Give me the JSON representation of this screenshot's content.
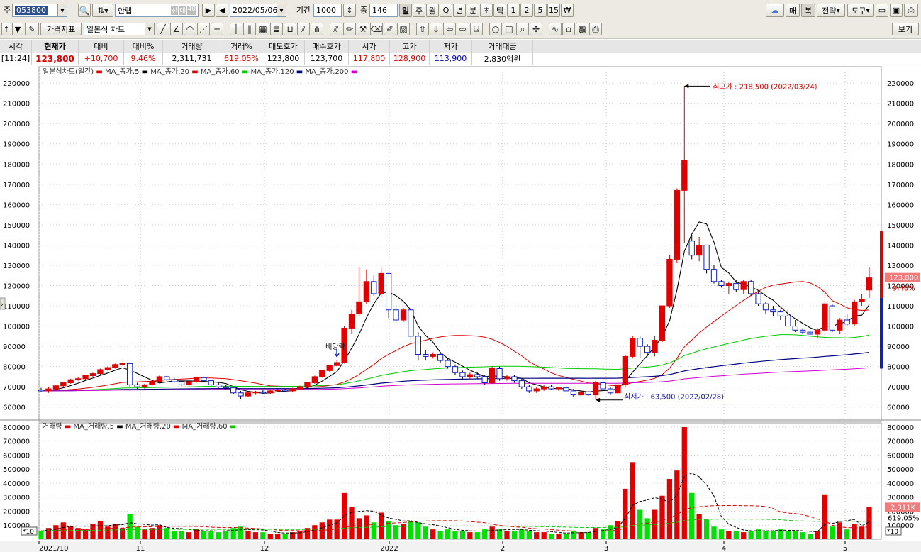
{
  "toolbar1": {
    "market_label": "주",
    "code": "053800",
    "name": "안랩",
    "badge_credit": "신",
    "badge_margin": "대",
    "badge_rate": "40",
    "date": "2022/05/06",
    "period_label": "기간",
    "period": "1000",
    "count_label": "중",
    "count": "146",
    "intervals": [
      "일",
      "주",
      "월",
      "Q",
      "년",
      "분",
      "초",
      "틱",
      "1",
      "2",
      "5",
      "15",
      "₩"
    ],
    "right_buttons": [
      "매",
      "복",
      "전략",
      "도구"
    ]
  },
  "toolbar2": {
    "indicator_button": "가격지표",
    "chart_type": "일본식 차트",
    "view_button": "보기"
  },
  "quote": {
    "headers": [
      "시각",
      "현재가",
      "대비",
      "대비%",
      "거래량",
      "거래%",
      "매도호가",
      "매수호가",
      "시가",
      "고가",
      "저가",
      "거래대금"
    ],
    "values": [
      "[11:24]",
      "123,800",
      "+10,700",
      "9.46%",
      "2,311,731",
      "619.05%",
      "123,800",
      "123,700",
      "117,800",
      "128,900",
      "113,900",
      "2,830억원"
    ]
  },
  "price_legend": {
    "title": "일본식차트(일간)",
    "items": [
      "MA_종가,5",
      "MA_종가,20",
      "MA_종가,60",
      "MA_종가,120",
      "MA_종가,200"
    ]
  },
  "volume_legend": {
    "title": "거래량",
    "items": [
      "MA_거래량,5",
      "MA_거래량,20",
      "MA_거래량,60"
    ]
  },
  "annotations": {
    "high": "최고가 : 218,500 (2022/03/24)",
    "low": "최저가 : 63,500 (2022/02/28)",
    "dividend": "배당락",
    "price_tag": "123,800",
    "change_tag": "9.46%",
    "volume_tag": "2,311K",
    "volume_pct_tag": "619.05%",
    "volume_unit": "*10"
  },
  "price_axis": [
    "220000",
    "210000",
    "200000",
    "190000",
    "180000",
    "170000",
    "160000",
    "150000",
    "140000",
    "130000",
    "120000",
    "110000",
    "100000",
    "90000",
    "80000",
    "70000",
    "60000"
  ],
  "volume_axis": [
    "800000",
    "700000",
    "600000",
    "500000",
    "400000",
    "300000",
    "200000",
    "100000"
  ],
  "date_axis": [
    "2021/10",
    "11",
    "12",
    "2022",
    "2",
    "3",
    "4",
    "5"
  ],
  "colors": {
    "up": "#e00000",
    "down": "#1020c0",
    "ma5": "#000000",
    "ma20": "#e00000",
    "ma60": "#00cc00",
    "ma120": "#000080",
    "ma200": "#d000d0",
    "vol_up": "#e00000",
    "vol_down": "#00e000"
  },
  "chart_data": {
    "type": "candlestick",
    "ylim": [
      55000,
      226000
    ],
    "volume_ylim": [
      0,
      830000
    ],
    "candles": [
      [
        68500,
        69500,
        67500,
        68000,
        60000
      ],
      [
        68000,
        70000,
        67000,
        69000,
        80000
      ],
      [
        69000,
        71000,
        68500,
        70500,
        100000
      ],
      [
        70500,
        72500,
        70000,
        72000,
        120000
      ],
      [
        72000,
        74000,
        71500,
        73500,
        90000
      ],
      [
        73500,
        75000,
        73000,
        74000,
        80000
      ],
      [
        74000,
        76000,
        73500,
        75500,
        70000
      ],
      [
        75500,
        77000,
        75000,
        76500,
        110000
      ],
      [
        76500,
        79000,
        76000,
        78500,
        130000
      ],
      [
        78500,
        80000,
        78000,
        79500,
        90000
      ],
      [
        79500,
        81500,
        79000,
        81000,
        110000
      ],
      [
        81000,
        82000,
        80500,
        81500,
        80000
      ],
      [
        81500,
        82000,
        70000,
        71000,
        180000
      ],
      [
        71000,
        72000,
        69000,
        70000,
        90000
      ],
      [
        70000,
        71500,
        69000,
        71000,
        70000
      ],
      [
        71000,
        73000,
        70500,
        72500,
        80000
      ],
      [
        72500,
        75500,
        72000,
        75000,
        100000
      ],
      [
        75000,
        75500,
        73000,
        73500,
        80000
      ],
      [
        73500,
        74500,
        72000,
        72500,
        60000
      ],
      [
        72500,
        73000,
        70500,
        71000,
        60000
      ],
      [
        71000,
        73000,
        70500,
        72500,
        50000
      ],
      [
        72500,
        75000,
        72000,
        74500,
        70000
      ],
      [
        74500,
        75000,
        72500,
        73000,
        60000
      ],
      [
        73000,
        73500,
        70500,
        71000,
        60000
      ],
      [
        71000,
        72000,
        69500,
        70000,
        50000
      ],
      [
        70000,
        71000,
        68500,
        69500,
        60000
      ],
      [
        69500,
        70000,
        66500,
        67000,
        80000
      ],
      [
        67000,
        68000,
        64000,
        65500,
        90000
      ],
      [
        65500,
        67500,
        65000,
        67000,
        60000
      ],
      [
        67000,
        68000,
        66000,
        67500,
        50000
      ],
      [
        67500,
        68500,
        66500,
        67000,
        50000
      ],
      [
        67000,
        68500,
        66500,
        68000,
        40000
      ],
      [
        68000,
        69000,
        67500,
        68500,
        40000
      ],
      [
        68500,
        69000,
        67500,
        68000,
        40000
      ],
      [
        68000,
        69500,
        67500,
        69000,
        50000
      ],
      [
        69000,
        70500,
        68500,
        70000,
        60000
      ],
      [
        70000,
        72500,
        69500,
        72000,
        80000
      ],
      [
        72000,
        75500,
        71500,
        75000,
        100000
      ],
      [
        75000,
        78500,
        74500,
        78000,
        120000
      ],
      [
        78000,
        81000,
        77500,
        80500,
        140000
      ],
      [
        80500,
        83000,
        80000,
        82000,
        140000
      ],
      [
        82000,
        100000,
        81500,
        99000,
        330000
      ],
      [
        99000,
        108000,
        96000,
        106000,
        230000
      ],
      [
        106000,
        129000,
        105000,
        112000,
        150000
      ],
      [
        112000,
        128000,
        111000,
        122000,
        170000
      ],
      [
        122000,
        125000,
        115000,
        116000,
        120000
      ],
      [
        116000,
        129000,
        114000,
        126000,
        190000
      ],
      [
        126000,
        115000,
        104000,
        108000,
        130000
      ],
      [
        108000,
        110000,
        101000,
        103000,
        100000
      ],
      [
        103000,
        109000,
        102000,
        108000,
        110000
      ],
      [
        108000,
        100000,
        91000,
        95000,
        130000
      ],
      [
        95000,
        97000,
        83000,
        86000,
        120000
      ],
      [
        86000,
        88000,
        83000,
        85000,
        90000
      ],
      [
        85000,
        87000,
        84000,
        86000,
        70000
      ],
      [
        86000,
        87000,
        82000,
        83000,
        60000
      ],
      [
        83000,
        84000,
        79000,
        80000,
        70000
      ],
      [
        80000,
        81000,
        76000,
        77000,
        60000
      ],
      [
        77000,
        78000,
        74000,
        75000,
        60000
      ],
      [
        75000,
        77000,
        74000,
        76000,
        50000
      ],
      [
        76000,
        77000,
        74000,
        75000,
        50000
      ],
      [
        75000,
        76000,
        71000,
        72000,
        70000
      ],
      [
        72000,
        80000,
        71500,
        79000,
        90000
      ],
      [
        79000,
        80000,
        73000,
        74000,
        70000
      ],
      [
        74000,
        76000,
        73000,
        75000,
        60000
      ],
      [
        75000,
        76000,
        72000,
        73000,
        60000
      ],
      [
        73000,
        74000,
        69000,
        70000,
        70000
      ],
      [
        70000,
        71000,
        67000,
        68000,
        60000
      ],
      [
        68000,
        70000,
        67000,
        69000,
        50000
      ],
      [
        69000,
        71000,
        68000,
        70000,
        50000
      ],
      [
        70000,
        71000,
        68500,
        69000,
        40000
      ],
      [
        69000,
        70000,
        68000,
        69500,
        40000
      ],
      [
        69500,
        70000,
        67500,
        68000,
        40000
      ],
      [
        68000,
        69000,
        65000,
        66000,
        60000
      ],
      [
        66000,
        68000,
        65500,
        67500,
        50000
      ],
      [
        67500,
        68000,
        65500,
        66000,
        50000
      ],
      [
        66000,
        73000,
        63500,
        72000,
        80000
      ],
      [
        72000,
        74000,
        68000,
        69000,
        70000
      ],
      [
        69000,
        70000,
        66000,
        67000,
        100000
      ],
      [
        67000,
        72000,
        66000,
        71000,
        130000
      ],
      [
        71000,
        86000,
        70000,
        85000,
        360000
      ],
      [
        85000,
        95000,
        84000,
        94000,
        550000
      ],
      [
        94000,
        95000,
        84000,
        90000,
        210000
      ],
      [
        90000,
        91000,
        85000,
        87000,
        150000
      ],
      [
        87000,
        95000,
        85000,
        93000,
        210000
      ],
      [
        93000,
        110000,
        92000,
        110000,
        310000
      ],
      [
        110000,
        135000,
        109000,
        133000,
        430000
      ],
      [
        133000,
        168000,
        131000,
        167000,
        490000
      ],
      [
        167000,
        218500,
        141000,
        182000,
        800000
      ],
      [
        142000,
        145000,
        133000,
        135000,
        330000
      ],
      [
        135000,
        144000,
        132000,
        140000,
        180000
      ],
      [
        140000,
        135000,
        126000,
        128000,
        140000
      ],
      [
        128000,
        130000,
        121000,
        122000,
        90000
      ],
      [
        122000,
        123000,
        119000,
        120000,
        70000
      ],
      [
        120000,
        122000,
        116000,
        121000,
        60000
      ],
      [
        121000,
        123000,
        117000,
        118000,
        60000
      ],
      [
        118000,
        123000,
        116000,
        122000,
        50000
      ],
      [
        122000,
        123000,
        115000,
        116000,
        60000
      ],
      [
        116000,
        117000,
        110000,
        111000,
        70000
      ],
      [
        111000,
        112000,
        106000,
        108000,
        60000
      ],
      [
        108000,
        110000,
        105000,
        107000,
        60000
      ],
      [
        107000,
        108000,
        103000,
        105000,
        70000
      ],
      [
        105000,
        108000,
        100000,
        100000,
        60000
      ],
      [
        100000,
        103000,
        97000,
        98000,
        60000
      ],
      [
        98000,
        99000,
        96000,
        97000,
        50000
      ],
      [
        97000,
        99000,
        95000,
        96000,
        40000
      ],
      [
        96000,
        99000,
        94000,
        98000,
        60000
      ],
      [
        98000,
        118000,
        93000,
        111000,
        320000
      ],
      [
        110000,
        111000,
        97000,
        98000,
        90000
      ],
      [
        98000,
        104000,
        96000,
        103000,
        120000
      ],
      [
        103000,
        106000,
        100000,
        101000,
        70000
      ],
      [
        101000,
        113000,
        100000,
        112000,
        110000
      ],
      [
        112000,
        116000,
        110000,
        113000,
        90000
      ],
      [
        117800,
        128900,
        113900,
        123800,
        231000
      ]
    ]
  }
}
